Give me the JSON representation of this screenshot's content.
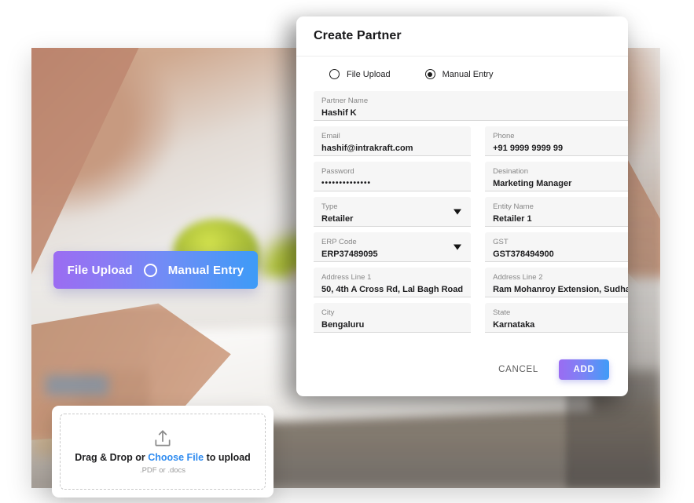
{
  "modal": {
    "title": "Create Partner",
    "mode_options": [
      {
        "label": "File Upload",
        "selected": false
      },
      {
        "label": "Manual Entry",
        "selected": true
      }
    ],
    "fields": [
      {
        "label": "Partner Name",
        "value": "Hashif K",
        "full_width": true,
        "dropdown": false
      },
      {
        "label": "Email",
        "value": "hashif@intrakraft.com",
        "dropdown": false
      },
      {
        "label": "Phone",
        "value": "+91 9999 9999 99",
        "dropdown": false
      },
      {
        "label": "Password",
        "value": "••••••••••••••",
        "dropdown": false
      },
      {
        "label": "Desination",
        "value": "Marketing Manager",
        "dropdown": false
      },
      {
        "label": "Type",
        "value": "Retailer",
        "dropdown": true
      },
      {
        "label": "Entity Name",
        "value": "Retailer 1",
        "dropdown": false
      },
      {
        "label": "ERP Code",
        "value": "ERP37489095",
        "dropdown": true
      },
      {
        "label": "GST",
        "value": "GST378494900",
        "dropdown": false
      },
      {
        "label": "Address Line 1",
        "value": "50, 4th A Cross Rd, Lal Bagh Road",
        "dropdown": false
      },
      {
        "label": "Address Line 2",
        "value": "Ram Mohanroy Extension, Sudha Nagar",
        "dropdown": false
      },
      {
        "label": "City",
        "value": "Bengaluru",
        "dropdown": false
      },
      {
        "label": "State",
        "value": "Karnataka",
        "dropdown": false
      }
    ],
    "footer": {
      "cancel_label": "CANCEL",
      "add_label": "ADD",
      "add_gradient_from": "#9a6cf2",
      "add_gradient_to": "#3f9cf7"
    }
  },
  "toggle_pill": {
    "left_label": "File Upload",
    "right_label": "Manual Entry",
    "gradient_from": "#9b6cf2",
    "gradient_to": "#3d9bf7"
  },
  "upload_card": {
    "text_before_link": "Drag & Drop or ",
    "link_label": "Choose File",
    "text_after_link": " to upload",
    "hint": ".PDF or .docs",
    "link_color": "#2e8bf0",
    "icon": "upload-icon"
  }
}
